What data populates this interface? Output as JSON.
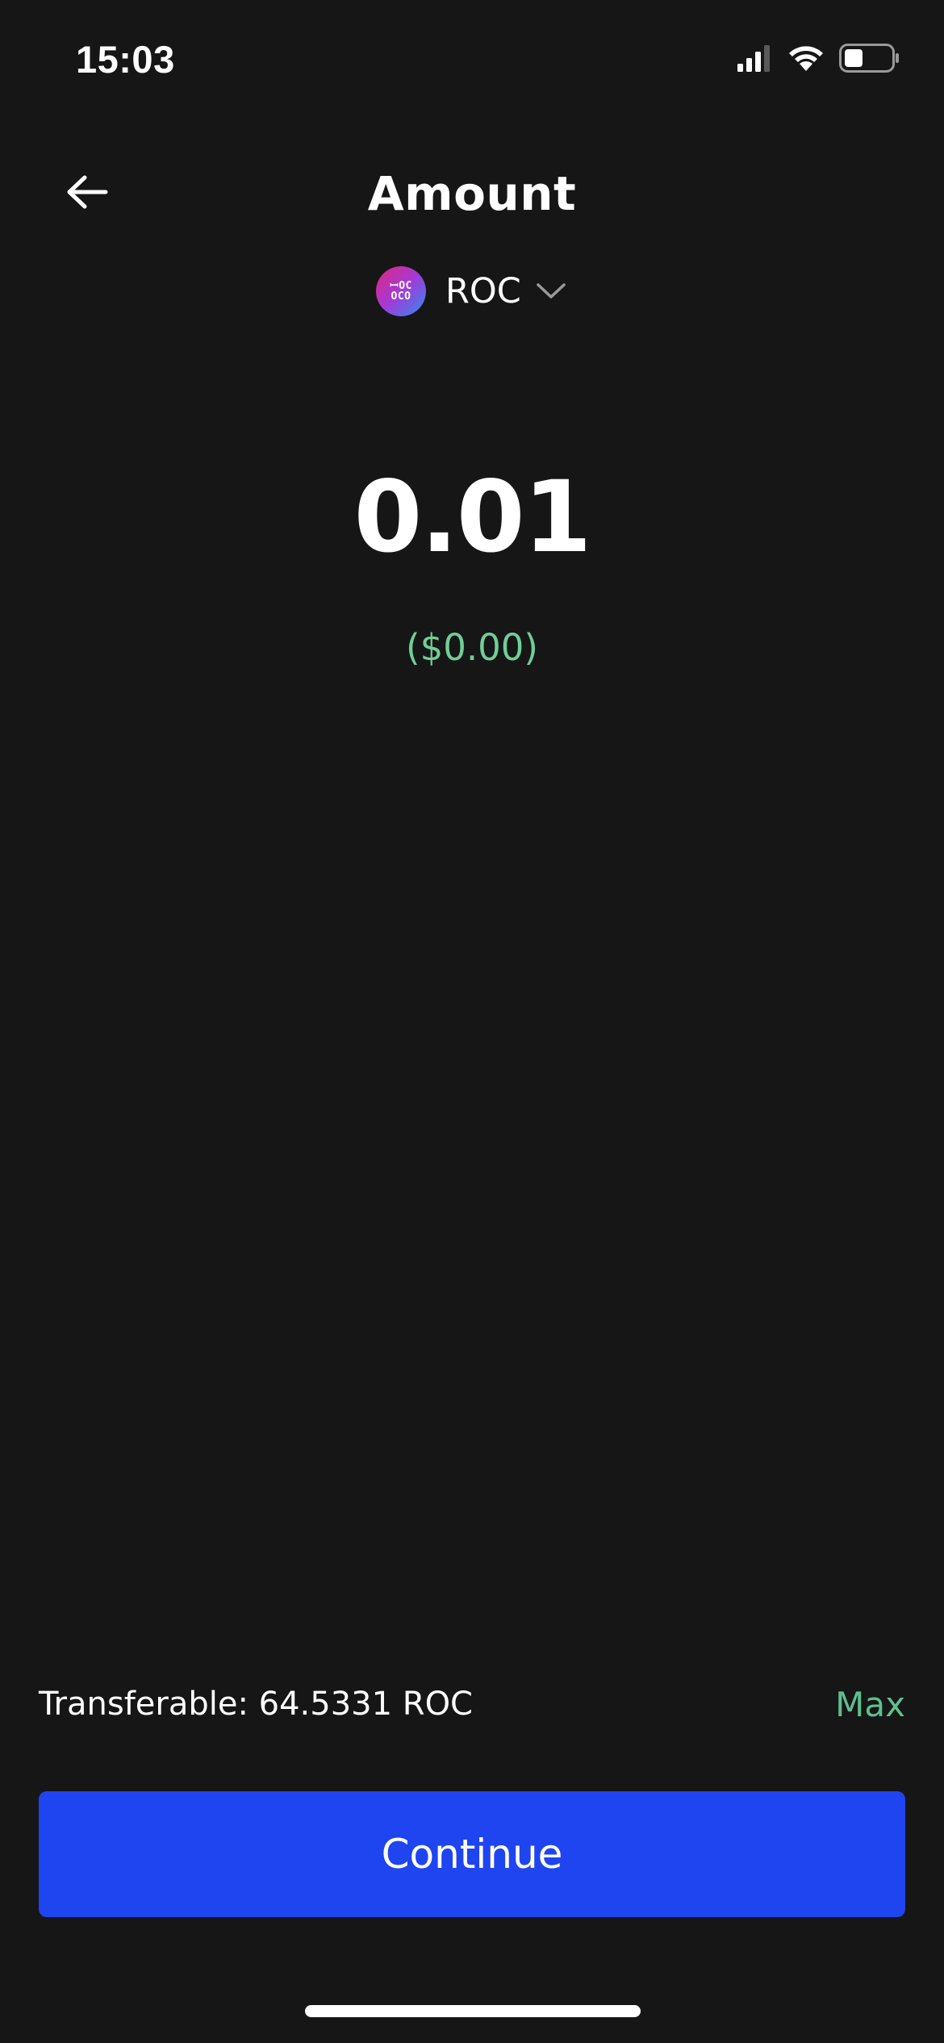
{
  "status_bar": {
    "time": "15:03",
    "icons": [
      "cellular-signal-icon",
      "wifi-icon",
      "battery-icon"
    ]
  },
  "header": {
    "title": "Amount",
    "back_icon": "arrow-left-icon"
  },
  "token": {
    "symbol": "ROC",
    "logo_line1": "ꟷOC",
    "logo_line2": "OCO",
    "chevron_icon": "chevron-down-icon"
  },
  "amount": {
    "value": "0.01",
    "fiat": "($0.00)"
  },
  "footer": {
    "transferable": "Transferable: 64.5331 ROC",
    "max_label": "Max",
    "continue_label": "Continue"
  },
  "colors": {
    "background": "#161616",
    "accent_green": "#6fcf97",
    "primary_button": "#1f45f0"
  }
}
